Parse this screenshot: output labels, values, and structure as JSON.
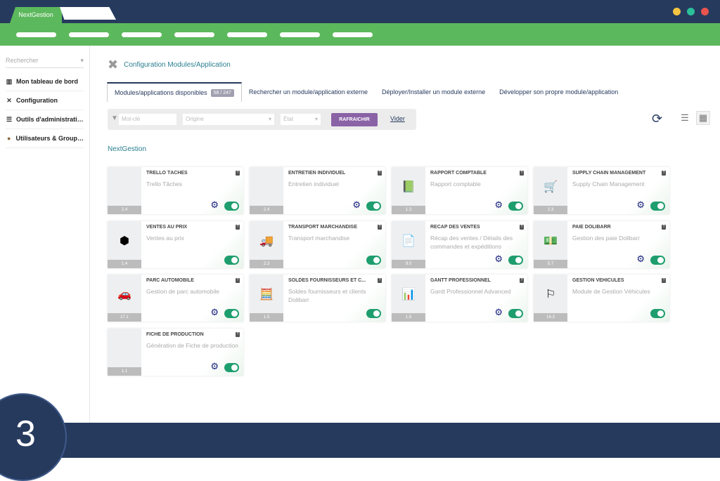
{
  "app": {
    "tab_label": "NextGestion",
    "window_dots": [
      "#f4c542",
      "#2bbf9a",
      "#e8544e"
    ]
  },
  "sidebar": {
    "search_placeholder": "Rechercher",
    "items": [
      {
        "label": "Mon tableau de bord",
        "icon": "chart-icon"
      },
      {
        "label": "Configuration",
        "icon": "tools-icon"
      },
      {
        "label": "Outils d'administrati…",
        "icon": "server-icon"
      },
      {
        "label": "Utilisateurs & Group…",
        "icon": "user-icon"
      }
    ]
  },
  "page": {
    "title": "Configuration Modules/Application",
    "section": "NextGestion",
    "step": "3"
  },
  "tabs": [
    {
      "label": "Modules/applications disponibles",
      "badge": "58 / 247"
    },
    {
      "label": "Rechercher un module/application externe"
    },
    {
      "label": "Déployer/Installer un module externe"
    },
    {
      "label": "Développer son propre module/application"
    }
  ],
  "filters": {
    "keyword_placeholder": "Mot-clé",
    "origin_placeholder": "Origine",
    "state_placeholder": "État",
    "refresh_label": "RAFRAICHIR",
    "clear_label": "Vider"
  },
  "modules": [
    {
      "name": "TRELLO TÂCHES",
      "desc": "Trello Tâches",
      "version": "2.4",
      "icon": "",
      "gear": true
    },
    {
      "name": "ENTRETIEN INDIVIDUEL",
      "desc": "Entretien individuel",
      "version": "2.4",
      "icon": "",
      "gear": true
    },
    {
      "name": "RAPPORT COMPTABLE",
      "desc": "Rapport comptable",
      "version": "1.3",
      "icon": "📗",
      "gear": true
    },
    {
      "name": "SUPPLY CHAIN MANAGEMENT",
      "desc": "Supply Chain Management",
      "version": "2.3",
      "icon": "🛒",
      "gear": true
    },
    {
      "name": "VENTES AU PRIX",
      "desc": "Ventes au prix",
      "version": "1.4",
      "icon": "⬢",
      "gear": false
    },
    {
      "name": "TRANSPORT MARCHANDISE",
      "desc": "Transport marchandise",
      "version": "2.3",
      "icon": "🚚",
      "gear": false
    },
    {
      "name": "RÉCAP DES VENTES",
      "desc": "Récap des ventes / Détails des commandes et expéditions",
      "version": "9.0",
      "icon": "📄",
      "gear": true
    },
    {
      "name": "PAIE DOLIBARR",
      "desc": "Gestion des paie Dolibarr",
      "version": "5.7",
      "icon": "💵",
      "gear": true
    },
    {
      "name": "PARC AUTOMOBILE",
      "desc": "Gestion de parc automobile",
      "version": "17.1",
      "icon": "🚗",
      "gear": true
    },
    {
      "name": "SOLDES FOURNISSEURS ET C...",
      "desc": "Soldes fournisseurs et clients Dolibarr",
      "version": "1.5",
      "icon": "🧮",
      "gear": false
    },
    {
      "name": "GANTT PROFESSIONNEL",
      "desc": "Gantt Professionnel Advanced",
      "version": "1.5",
      "icon": "📊",
      "gear": true
    },
    {
      "name": "GESTION VÉHICULES",
      "desc": "Module de Gestion Véhicules",
      "version": "14.3",
      "icon": "⚐",
      "gear": false
    },
    {
      "name": "FICHE DE PRODUCTION",
      "desc": "Génération de Fiche de production",
      "version": "1.1",
      "icon": "",
      "gear": true
    }
  ]
}
